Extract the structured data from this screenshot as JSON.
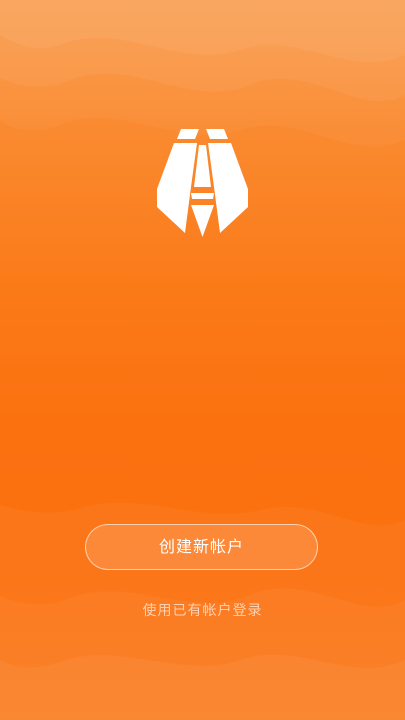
{
  "app": {
    "logo_icon": "cicada-logo-icon",
    "colors": {
      "background_top": "#f99a4a",
      "background_main": "#fb700f",
      "button_border": "#ffffff",
      "text": "#ffffff"
    }
  },
  "actions": {
    "create_account_label": "创建新帐户",
    "login_label": "使用已有帐户登录"
  }
}
